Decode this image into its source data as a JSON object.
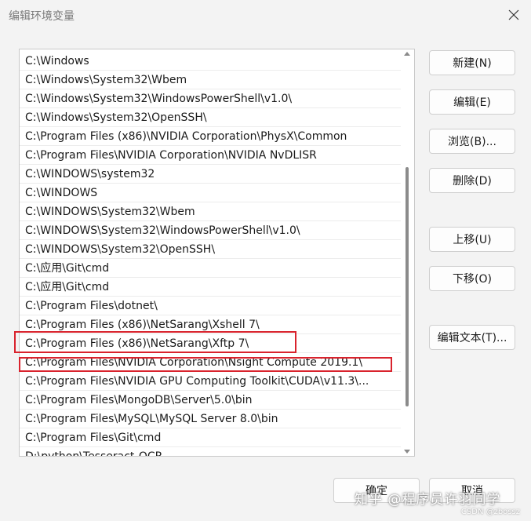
{
  "window": {
    "title": "编辑环境变量"
  },
  "icons": {
    "close": "close-icon"
  },
  "path_list": [
    "C:\\Windows",
    "C:\\Windows\\System32\\Wbem",
    "C:\\Windows\\System32\\WindowsPowerShell\\v1.0\\",
    "C:\\Windows\\System32\\OpenSSH\\",
    "C:\\Program Files (x86)\\NVIDIA Corporation\\PhysX\\Common",
    "C:\\Program Files\\NVIDIA Corporation\\NVIDIA NvDLISR",
    "C:\\WINDOWS\\system32",
    "C:\\WINDOWS",
    "C:\\WINDOWS\\System32\\Wbem",
    "C:\\WINDOWS\\System32\\WindowsPowerShell\\v1.0\\",
    "C:\\WINDOWS\\System32\\OpenSSH\\",
    "C:\\应用\\Git\\cmd",
    "C:\\应用\\Git\\cmd",
    "C:\\Program Files\\dotnet\\",
    "C:\\Program Files (x86)\\NetSarang\\Xshell 7\\",
    "C:\\Program Files (x86)\\NetSarang\\Xftp 7\\",
    "C:\\Program Files\\NVIDIA Corporation\\Nsight Compute 2019.1\\",
    "C:\\Program Files\\NVIDIA GPU Computing Toolkit\\CUDA\\v11.3\\...",
    "C:\\Program Files\\MongoDB\\Server\\5.0\\bin",
    "C:\\Program Files\\MySQL\\MySQL Server 8.0\\bin",
    "C:\\Program Files\\Git\\cmd",
    "D:\\python\\Tesseract-OCR"
  ],
  "buttons": {
    "new": "新建(N)",
    "edit": "编辑(E)",
    "browse": "浏览(B)...",
    "delete": "删除(D)",
    "move_up": "上移(U)",
    "move_down": "下移(O)",
    "edit_text": "编辑文本(T)...",
    "ok": "确定",
    "cancel": "取消"
  },
  "watermark": {
    "text": "知乎 @程序员许羽同学",
    "csdn": "CSDN @zbossz"
  },
  "colors": {
    "highlight": "#d9232d",
    "background": "#f3f3f3"
  }
}
